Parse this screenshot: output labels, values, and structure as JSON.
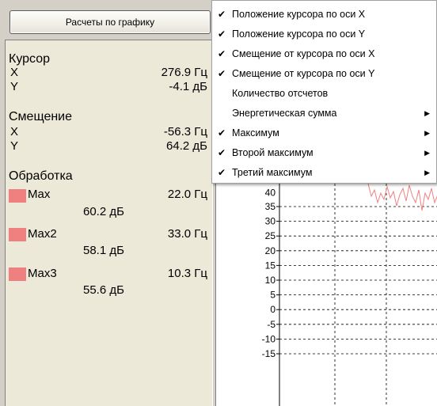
{
  "button": {
    "label": "Расчеты по графику"
  },
  "panel": {
    "cursor": {
      "title": "Курсор",
      "x_label": "X",
      "x_value": "276.9 Гц",
      "y_label": "Y",
      "y_value": "-4.1 дБ"
    },
    "offset": {
      "title": "Смещение",
      "x_label": "X",
      "x_value": "-56.3 Гц",
      "y_label": "Y",
      "y_value": "64.2 дБ"
    },
    "processing": {
      "title": "Обработка",
      "items": [
        {
          "label": "Max",
          "freq": "22.0 Гц",
          "db": "60.2 дБ",
          "color": "#f08080"
        },
        {
          "label": "Max2",
          "freq": "33.0 Гц",
          "db": "58.1 дБ",
          "color": "#f08080"
        },
        {
          "label": "Max3",
          "freq": "10.3 Гц",
          "db": "55.6 дБ",
          "color": "#f08080"
        }
      ]
    }
  },
  "menu": {
    "items": [
      {
        "label": "Положение курсора по оси X",
        "checked": true,
        "submenu": false
      },
      {
        "label": "Положение курсора по оси Y",
        "checked": true,
        "submenu": false
      },
      {
        "label": "Смещение от курсора по оси X",
        "checked": true,
        "submenu": false
      },
      {
        "label": "Смещение от курсора по оси Y",
        "checked": true,
        "submenu": false
      },
      {
        "label": "Количество отсчетов",
        "checked": false,
        "submenu": false
      },
      {
        "label": "Энергетическая сумма",
        "checked": false,
        "submenu": true
      },
      {
        "label": "Максимум",
        "checked": true,
        "submenu": true
      },
      {
        "label": "Второй максимум",
        "checked": true,
        "submenu": true
      },
      {
        "label": "Третий максимум",
        "checked": true,
        "submenu": true
      }
    ],
    "check_glyph": "✔",
    "arrow_glyph": "▶"
  },
  "chart": {
    "y_ticks": [
      "35",
      "30",
      "25",
      "20",
      "15",
      "10",
      "5",
      "0",
      "-5",
      "-10",
      "-15"
    ],
    "y_top_partial": "40",
    "line_color": "#f08080",
    "grid_color": "#000000"
  }
}
